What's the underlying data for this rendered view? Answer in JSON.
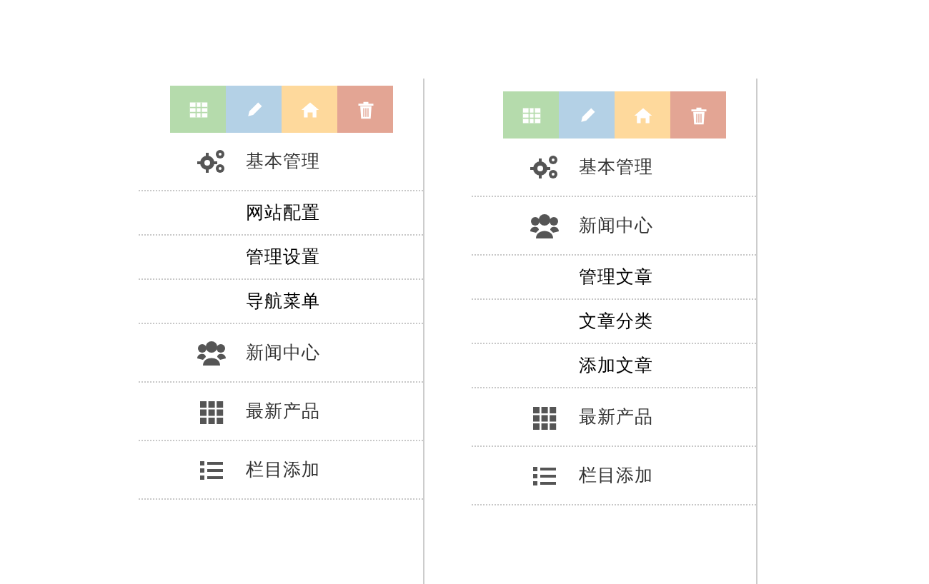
{
  "menus": [
    {
      "toolbar": [
        {
          "kind": "table",
          "color": "#b5dbac"
        },
        {
          "kind": "pencil",
          "color": "#b4d1e6"
        },
        {
          "kind": "home",
          "color": "#fed99c"
        },
        {
          "kind": "trash",
          "color": "#e3a594"
        }
      ],
      "items": [
        {
          "kind": "gears",
          "label": "基本管理",
          "children": [
            {
              "label": "网站配置"
            },
            {
              "label": "管理设置"
            },
            {
              "label": "导航菜单"
            }
          ]
        },
        {
          "kind": "users",
          "label": "新闻中心"
        },
        {
          "kind": "grid",
          "label": "最新产品"
        },
        {
          "kind": "list",
          "label": "栏目添加"
        }
      ]
    },
    {
      "toolbar": [
        {
          "kind": "table",
          "color": "#b5dbac"
        },
        {
          "kind": "pencil",
          "color": "#b4d1e6"
        },
        {
          "kind": "home",
          "color": "#fed99c"
        },
        {
          "kind": "trash",
          "color": "#e3a594"
        }
      ],
      "items": [
        {
          "kind": "gears",
          "label": "基本管理"
        },
        {
          "kind": "users",
          "label": "新闻中心",
          "children": [
            {
              "label": "管理文章"
            },
            {
              "label": "文章分类"
            },
            {
              "label": "添加文章"
            }
          ]
        },
        {
          "kind": "grid",
          "label": "最新产品"
        },
        {
          "kind": "list",
          "label": "栏目添加"
        }
      ]
    }
  ]
}
